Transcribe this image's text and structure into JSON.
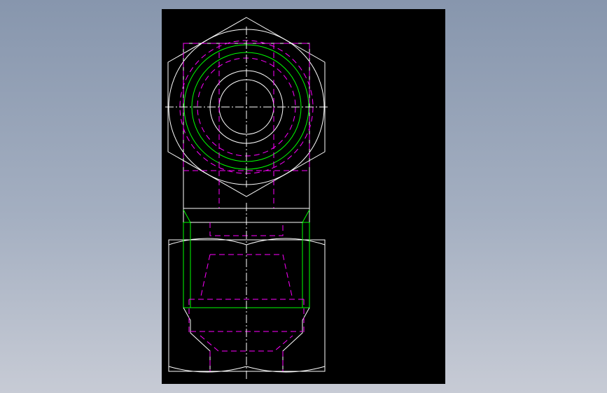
{
  "viewer": {
    "background_gradient": [
      "#8796ad",
      "#c7cbd5"
    ],
    "sheet_color": "#000000"
  },
  "drawing": {
    "line_colors": {
      "visible_edge": "#ffffff",
      "thread_edge": "#00ff00",
      "hidden_edge": "#ff00ff",
      "center_line": "#ffffff"
    },
    "views": [
      "top-view",
      "front-view"
    ]
  }
}
